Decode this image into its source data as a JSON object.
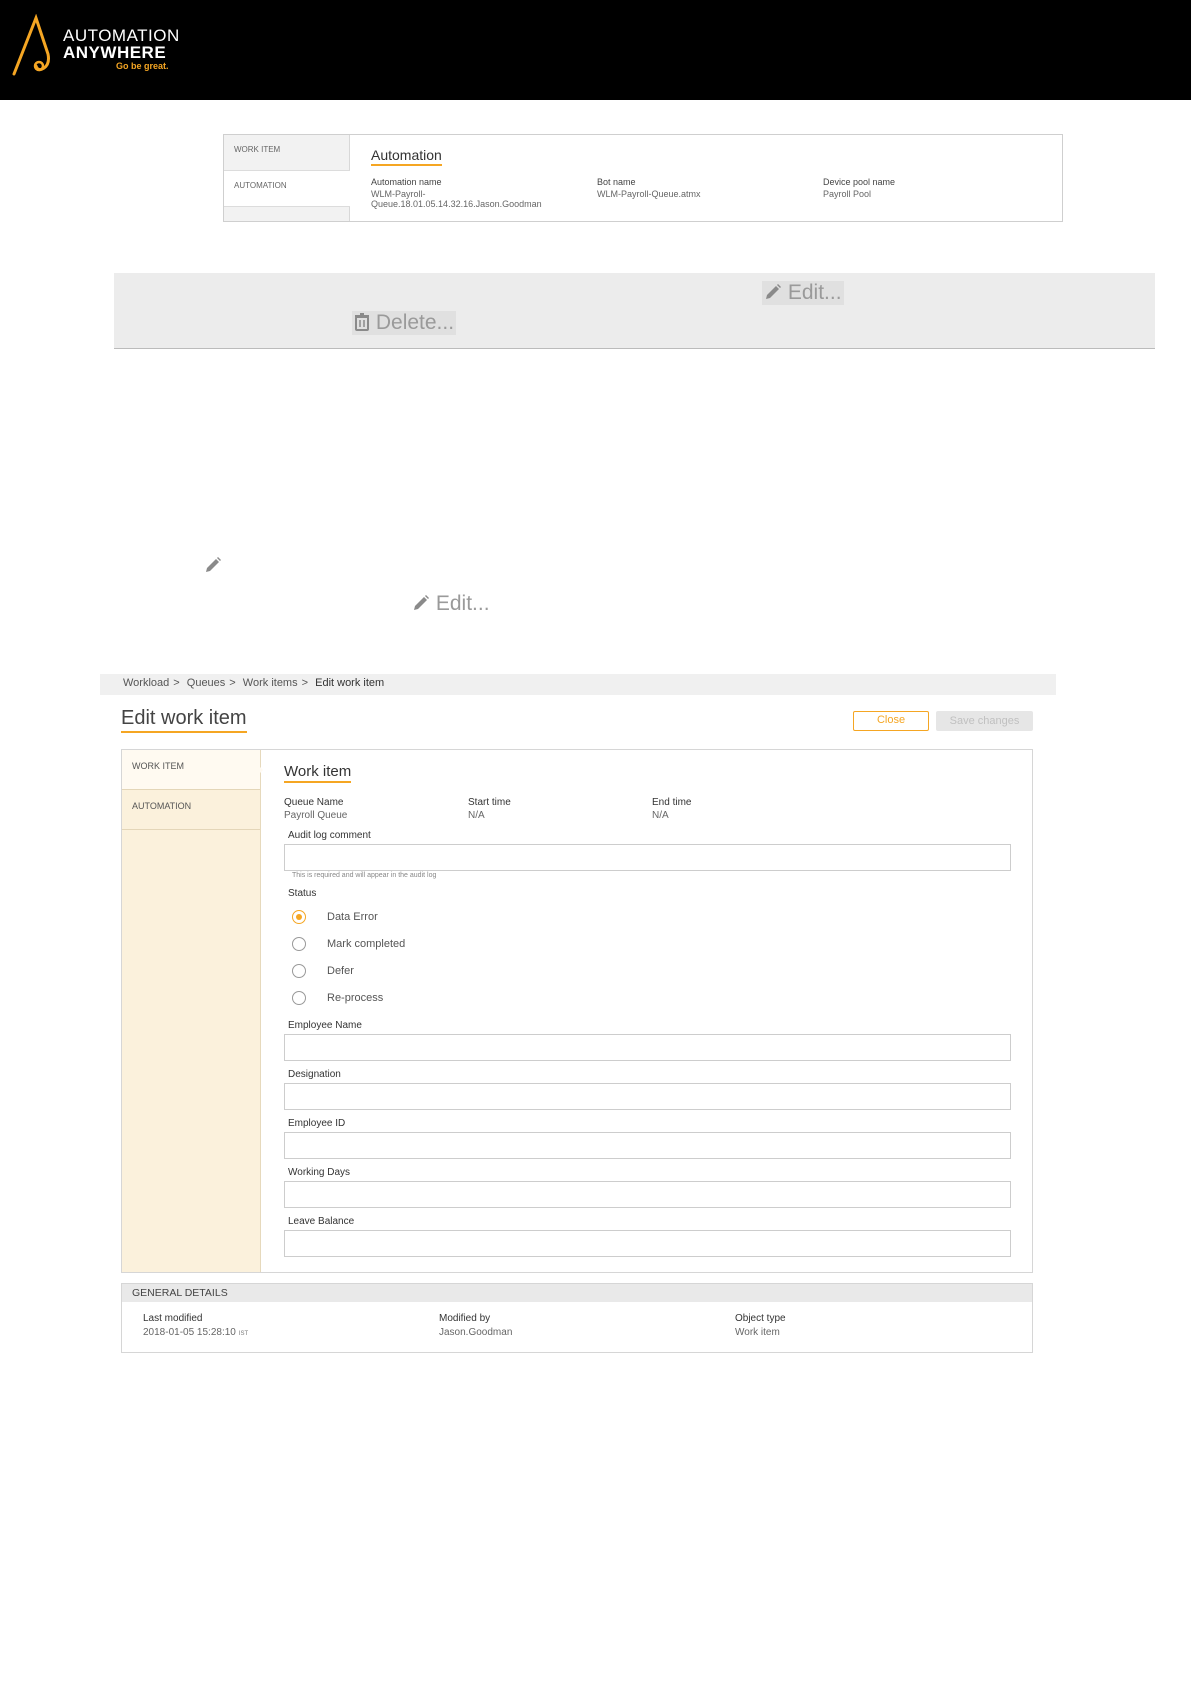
{
  "brand": {
    "line1": "AUTOMATION",
    "line2": "ANYWHERE",
    "tagline": "Go be great.",
    "accent": "#f5a623"
  },
  "automation_panel": {
    "tabs": [
      "WORK ITEM",
      "AUTOMATION"
    ],
    "title": "Automation",
    "columns": [
      {
        "label": "Automation name",
        "value": "WLM-Payroll-\nQueue.18.01.05.14.32.16.Jason.Goodman"
      },
      {
        "label": "Bot name",
        "value": "WLM-Payroll-Queue.atmx"
      },
      {
        "label": "Device pool name",
        "value": "Payroll Pool"
      }
    ]
  },
  "toolbar": {
    "edit_label": "Edit...",
    "delete_label": "Delete...",
    "edit_icon": "pencil-icon",
    "delete_icon": "trash-icon"
  },
  "inline_edit": {
    "edit_label": "Edit..."
  },
  "breadcrumb": [
    "Workload",
    "Queues",
    "Work items",
    "Edit work item"
  ],
  "page": {
    "title": "Edit work item",
    "close_label": "Close",
    "save_label": "Save changes"
  },
  "form": {
    "tabs": [
      "WORK ITEM",
      "AUTOMATION"
    ],
    "section_title": "Work item",
    "info": [
      {
        "label": "Queue Name",
        "value": "Payroll Queue"
      },
      {
        "label": "Start time",
        "value": "N/A"
      },
      {
        "label": "End time",
        "value": "N/A"
      }
    ],
    "audit_label": "Audit log comment",
    "audit_value": "",
    "audit_hint": "This is required and will appear in the audit log",
    "status_label": "Status",
    "status_options": [
      "Data Error",
      "Mark completed",
      "Defer",
      "Re-process"
    ],
    "status_selected": "Data Error",
    "fields": [
      {
        "label": "Employee Name",
        "value": ""
      },
      {
        "label": "Designation",
        "value": ""
      },
      {
        "label": "Employee ID",
        "value": ""
      },
      {
        "label": "Working Days",
        "value": ""
      },
      {
        "label": "Leave Balance",
        "value": ""
      }
    ]
  },
  "general_details": {
    "header": "GENERAL DETAILS",
    "items": [
      {
        "label": "Last modified",
        "value": "2018-01-05 15:28:10",
        "suffix": "IST"
      },
      {
        "label": "Modified by",
        "value": "Jason.Goodman"
      },
      {
        "label": "Object type",
        "value": "Work item"
      }
    ]
  }
}
